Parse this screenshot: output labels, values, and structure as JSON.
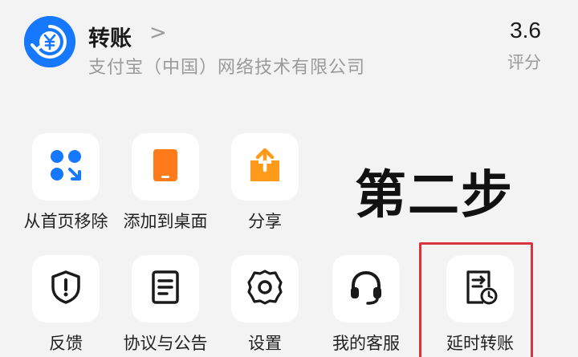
{
  "app": {
    "name": "转账",
    "chevron": ">",
    "company": "支付宝（中国）网络技术有限公司",
    "rating_value": "3.6",
    "rating_label": "评分",
    "logo_icon": "yuan-transfer-icon",
    "logo_color": "#1677ff"
  },
  "actions_row1": [
    {
      "label": "从首页移除",
      "icon": "remove-from-home-icon"
    },
    {
      "label": "添加到桌面",
      "icon": "add-to-desktop-icon"
    },
    {
      "label": "分享",
      "icon": "share-icon"
    }
  ],
  "actions_row2": [
    {
      "label": "反馈",
      "icon": "feedback-shield-icon"
    },
    {
      "label": "协议与公告",
      "icon": "document-icon"
    },
    {
      "label": "设置",
      "icon": "settings-gear-icon"
    },
    {
      "label": "我的客服",
      "icon": "headset-icon"
    },
    {
      "label": "延时转账",
      "icon": "delayed-transfer-icon"
    }
  ],
  "annotation": {
    "step_text": "第二步",
    "highlight_color": "#d9333f"
  },
  "colors": {
    "background": "#f3f3f3",
    "tile": "#ffffff",
    "blue": "#1677ff",
    "orange": "#ff7a1a"
  }
}
